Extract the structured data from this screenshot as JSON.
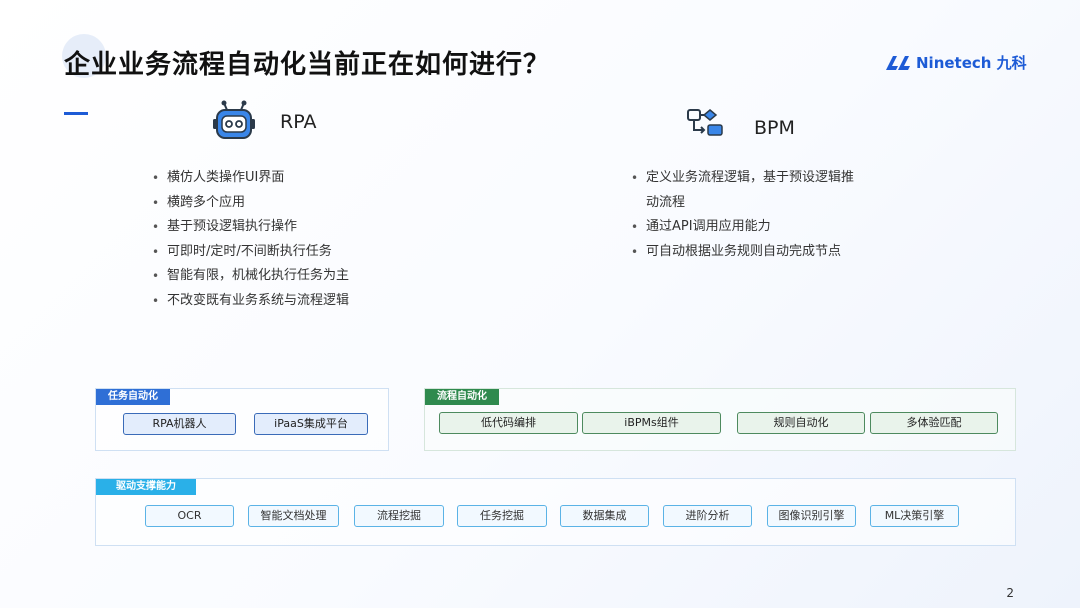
{
  "title": "企业业务流程自动化当前正在如何进行？",
  "logo": {
    "text": "Ninetech 九科",
    "brand_color": "#1d5bd6"
  },
  "rpa": {
    "label": "RPA",
    "icon": "robot-icon",
    "bullets": [
      "横仿人类操作UI界面",
      "横跨多个应用",
      "基于预设逻辑执行操作",
      "可即时/定时/不间断执行任务",
      "智能有限，机械化执行任务为主",
      "不改变既有业务系统与流程逻辑"
    ]
  },
  "bpm": {
    "label": "BPM",
    "icon": "workflow-icon",
    "bullets": [
      "定义业务流程逻辑，基于预设逻辑推动流程",
      "通过API调用应用能力",
      "可自动根据业务规则自动完成节点"
    ]
  },
  "task_automation": {
    "tag": "任务自动化",
    "items": [
      "RPA机器人",
      "iPaaS集成平台"
    ]
  },
  "process_automation": {
    "tag": "流程自动化",
    "items": [
      "低代码编排",
      "iBPMs组件",
      "规则自动化",
      "多体验匹配"
    ]
  },
  "support": {
    "tag": "驱动支撑能力",
    "items": [
      "OCR",
      "智能文档处理",
      "流程挖掘",
      "任务挖掘",
      "数据集成",
      "进阶分析",
      "图像识别引擎",
      "ML决策引擎"
    ]
  },
  "page_number": "2",
  "colors": {
    "accent": "#1d5bd6",
    "task": "#2f6fd6",
    "process": "#2f8a4e",
    "support": "#2ab0e8"
  }
}
